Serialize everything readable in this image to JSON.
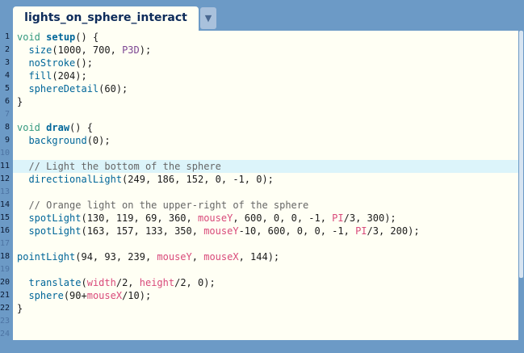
{
  "tab": {
    "title": "lights_on_sphere_interact",
    "menu_icon": "dropdown-arrow-icon"
  },
  "colors": {
    "background": "#6c9ac6",
    "editor_bg": "#fffff4",
    "highlight_line": "#dcf4fa"
  },
  "highlighted_line": 11,
  "lines": [
    {
      "n": "1",
      "tokens": [
        {
          "t": "void",
          "c": "kw"
        },
        {
          "t": " "
        },
        {
          "t": "setup",
          "c": "fn"
        },
        {
          "t": "() {"
        }
      ]
    },
    {
      "n": "2",
      "tokens": [
        {
          "t": "  "
        },
        {
          "t": "size",
          "c": "call"
        },
        {
          "t": "(1000, 700, "
        },
        {
          "t": "P3D",
          "c": "str"
        },
        {
          "t": ");"
        }
      ]
    },
    {
      "n": "3",
      "tokens": [
        {
          "t": "  "
        },
        {
          "t": "noStroke",
          "c": "call"
        },
        {
          "t": "();"
        }
      ]
    },
    {
      "n": "4",
      "tokens": [
        {
          "t": "  "
        },
        {
          "t": "fill",
          "c": "call"
        },
        {
          "t": "(204);"
        }
      ]
    },
    {
      "n": "5",
      "tokens": [
        {
          "t": "  "
        },
        {
          "t": "sphereDetail",
          "c": "call"
        },
        {
          "t": "(60);"
        }
      ]
    },
    {
      "n": "6",
      "tokens": [
        {
          "t": "}"
        }
      ]
    },
    {
      "n": "7",
      "tokens": []
    },
    {
      "n": "8",
      "tokens": [
        {
          "t": "void",
          "c": "kw"
        },
        {
          "t": " "
        },
        {
          "t": "draw",
          "c": "fn"
        },
        {
          "t": "() {"
        }
      ]
    },
    {
      "n": "9",
      "tokens": [
        {
          "t": "  "
        },
        {
          "t": "background",
          "c": "call"
        },
        {
          "t": "(0);"
        }
      ]
    },
    {
      "n": "10",
      "tokens": []
    },
    {
      "n": "11",
      "tokens": [
        {
          "t": "  "
        },
        {
          "t": "// Light the bottom of the sphere",
          "c": "cmt"
        }
      ]
    },
    {
      "n": "12",
      "tokens": [
        {
          "t": "  "
        },
        {
          "t": "directionalLight",
          "c": "call"
        },
        {
          "t": "(249, 186, 152, 0, -1, 0);"
        }
      ]
    },
    {
      "n": "13",
      "tokens": []
    },
    {
      "n": "14",
      "tokens": [
        {
          "t": "  "
        },
        {
          "t": "// Orange light on the upper-right of the sphere",
          "c": "cmt"
        }
      ]
    },
    {
      "n": "15",
      "tokens": [
        {
          "t": "  "
        },
        {
          "t": "spotLight",
          "c": "call"
        },
        {
          "t": "(130, 119, 69, 360, "
        },
        {
          "t": "mouseY",
          "c": "var"
        },
        {
          "t": ", 600, 0, 0, -1, "
        },
        {
          "t": "PI",
          "c": "var"
        },
        {
          "t": "/3, 300);"
        }
      ]
    },
    {
      "n": "16",
      "tokens": [
        {
          "t": "  "
        },
        {
          "t": "spotLight",
          "c": "call"
        },
        {
          "t": "(163, 157, 133, 350, "
        },
        {
          "t": "mouseY",
          "c": "var"
        },
        {
          "t": "-10, 600, 0, 0, -1, "
        },
        {
          "t": "PI",
          "c": "var"
        },
        {
          "t": "/3, 200);"
        }
      ]
    },
    {
      "n": "17",
      "tokens": []
    },
    {
      "n": "18",
      "tokens": [
        {
          "t": "pointLight",
          "c": "call"
        },
        {
          "t": "(94, 93, 239, "
        },
        {
          "t": "mouseY",
          "c": "var"
        },
        {
          "t": ", "
        },
        {
          "t": "mouseX",
          "c": "var"
        },
        {
          "t": ", 144);"
        }
      ]
    },
    {
      "n": "19",
      "tokens": []
    },
    {
      "n": "20",
      "tokens": [
        {
          "t": "  "
        },
        {
          "t": "translate",
          "c": "call"
        },
        {
          "t": "("
        },
        {
          "t": "width",
          "c": "var"
        },
        {
          "t": "/2, "
        },
        {
          "t": "height",
          "c": "var"
        },
        {
          "t": "/2, 0);"
        }
      ]
    },
    {
      "n": "21",
      "tokens": [
        {
          "t": "  "
        },
        {
          "t": "sphere",
          "c": "call"
        },
        {
          "t": "(90+"
        },
        {
          "t": "mouseX",
          "c": "var"
        },
        {
          "t": "/10);"
        }
      ]
    },
    {
      "n": "22",
      "tokens": [
        {
          "t": "}"
        }
      ]
    },
    {
      "n": "23",
      "tokens": []
    },
    {
      "n": "24",
      "tokens": []
    }
  ]
}
